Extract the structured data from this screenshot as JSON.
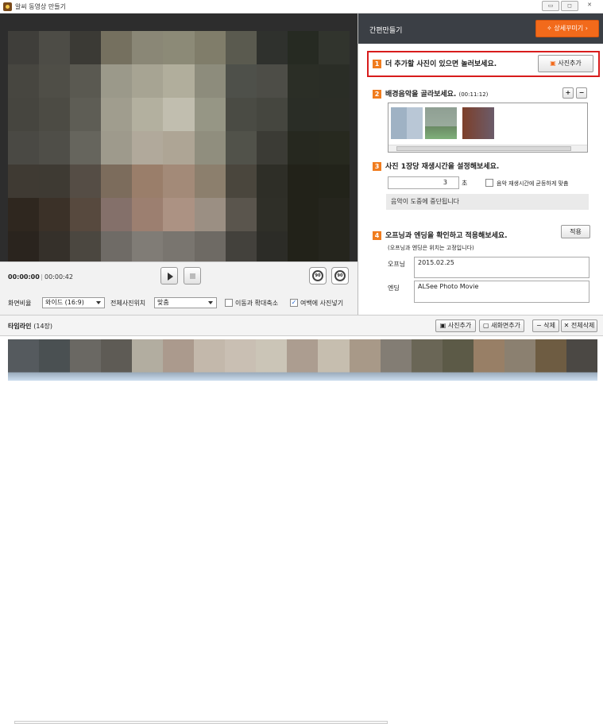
{
  "window": {
    "title": "알씨 동영상 만들기",
    "buttons": [
      "minimize",
      "maximize",
      "close"
    ]
  },
  "player": {
    "current_time": "00:00:00",
    "total_time": "00:00:42",
    "aspect_label": "화면비율",
    "aspect_value": "와이드 (16:9)",
    "position_label": "전체사진위치",
    "position_value": "맞춤",
    "move_zoom_label": "이동과 확대축소",
    "move_zoom_checked": false,
    "margin_label": "여백에 사진넣기",
    "margin_checked": true
  },
  "panel": {
    "title": "간편만들기",
    "detail_button": "상세꾸미기",
    "step1": {
      "num": "1",
      "text": "더 추가할 사진이 있으면 놀러보세요.",
      "button": "사진추가"
    },
    "step2": {
      "num": "2",
      "text": "배경음악을 골라보세요.",
      "duration": "(00:11:12)"
    },
    "step3": {
      "num": "3",
      "text": "사진 1장당 재생시간을 설정해보세요.",
      "seconds": "3",
      "unit": "초",
      "fit_label": "음악 재생시간에 균등하게 맞춤",
      "fit_checked": false,
      "notice": "음악이 도중에 중단됩니다"
    },
    "step4": {
      "num": "4",
      "text": "오프닝과 엔딩을 확인하고 적용해보세요.",
      "apply_button": "적용",
      "note": "(오프닝과 엔딩은 위치는 고정입니다)",
      "opening_label": "오프닝",
      "opening_value": "2015.02.25",
      "ending_label": "엔딩",
      "ending_value": "ALSee Photo Movie"
    }
  },
  "timeline": {
    "title": "타임라인",
    "count": "(14장)",
    "add_photo": "사진추가",
    "new_screen": "새화면추가",
    "delete": "삭제",
    "delete_all": "전체삭제"
  },
  "colors": {
    "accent": "#f26a1b",
    "highlight": "#d81c1c",
    "header_bg": "#3b3f45"
  },
  "icons": [
    "app-icon",
    "play-icon",
    "stop-icon",
    "rotate-left-icon",
    "rotate-right-icon",
    "add-photo-icon",
    "plus-icon",
    "minus-icon",
    "magic-wand-icon"
  ]
}
